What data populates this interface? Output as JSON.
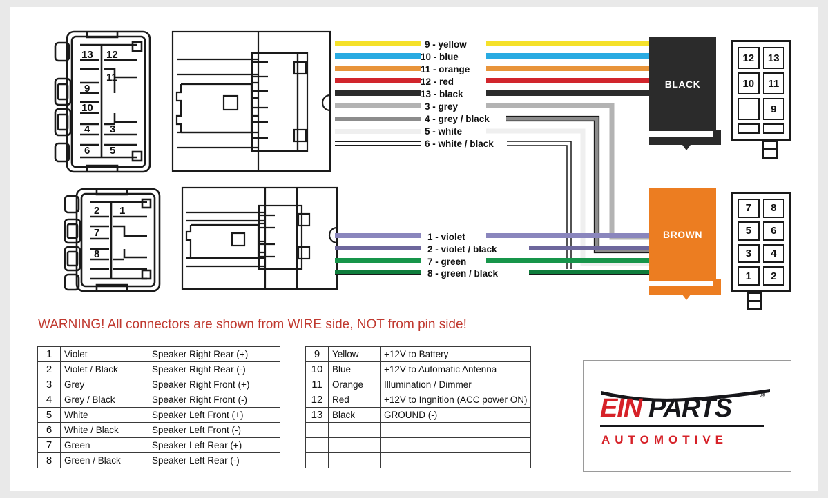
{
  "warning": {
    "text": "WARNING! All connectors are shown from WIRE side, NOT from pin side!",
    "color": "#c0392f"
  },
  "blocks": {
    "black": {
      "label": "BLACK",
      "color": "#2b2b2b",
      "text_color": "#ffffff"
    },
    "brown": {
      "label": "BROWN",
      "color": "#ec7d21",
      "text_color": "#ffffff"
    }
  },
  "wires_top": [
    {
      "pin": "9",
      "label": "9 - yellow",
      "color": "#f5e12a",
      "stripe": null
    },
    {
      "pin": "10",
      "label": "10 - blue",
      "color": "#29abe2",
      "stripe": null
    },
    {
      "pin": "11",
      "label": "11 - orange",
      "color": "#e8943a",
      "stripe": null
    },
    {
      "pin": "12",
      "label": "12 - red",
      "color": "#d1252c",
      "stripe": null
    },
    {
      "pin": "13",
      "label": "13 - black",
      "color": "#2b2b2b",
      "stripe": null
    },
    {
      "pin": "3",
      "label": "3 - grey",
      "color": "#b3b3b3",
      "stripe": null
    },
    {
      "pin": "4",
      "label": "4 - grey / black",
      "color": "#808080",
      "stripe": "#1a1a1a"
    },
    {
      "pin": "5",
      "label": "5 - white",
      "color": "#efefef",
      "stripe": null
    },
    {
      "pin": "6",
      "label": "6 - white / black",
      "color": "#ffffff",
      "stripe": "#1a1a1a"
    }
  ],
  "wires_bottom": [
    {
      "pin": "1",
      "label": "1 - violet",
      "color": "#8a86bd",
      "stripe": null
    },
    {
      "pin": "2",
      "label": "2 - violet / black",
      "color": "#6d679c",
      "stripe": "#1a1a1a"
    },
    {
      "pin": "7",
      "label": "7 - green",
      "color": "#17954a",
      "stripe": null
    },
    {
      "pin": "8",
      "label": "8 - green / black",
      "color": "#0f7d3c",
      "stripe": "#1a1a1a"
    }
  ],
  "connector_top_left": {
    "name": "13-pin connector",
    "pins": [
      "13",
      "12",
      "11",
      "9",
      "10",
      "4",
      "3",
      "6",
      "5"
    ]
  },
  "connector_bottom_left": {
    "name": "8-pin connector",
    "pins": [
      "2",
      "1",
      "7",
      "8"
    ]
  },
  "pingrid_black": {
    "rows": [
      [
        "12",
        "13"
      ],
      [
        "10",
        "11"
      ],
      [
        "",
        "9"
      ],
      [
        "",
        ""
      ]
    ]
  },
  "pingrid_brown": {
    "rows": [
      [
        "7",
        "8"
      ],
      [
        "5",
        "6"
      ],
      [
        "3",
        "4"
      ],
      [
        "1",
        "2"
      ]
    ]
  },
  "table_left": {
    "rows": [
      {
        "num": "1",
        "color": "Violet",
        "function": "Speaker Right Rear (+)"
      },
      {
        "num": "2",
        "color": "Violet / Black",
        "function": "Speaker Right Rear (-)"
      },
      {
        "num": "3",
        "color": "Grey",
        "function": "Speaker Right Front (+)"
      },
      {
        "num": "4",
        "color": "Grey / Black",
        "function": "Speaker Right Front (-)"
      },
      {
        "num": "5",
        "color": "White",
        "function": "Speaker Left Front (+)"
      },
      {
        "num": "6",
        "color": "White / Black",
        "function": "Speaker Left Front (-)"
      },
      {
        "num": "7",
        "color": "Green",
        "function": "Speaker Left Rear (+)"
      },
      {
        "num": "8",
        "color": "Green / Black",
        "function": "Speaker Left Rear (-)"
      }
    ]
  },
  "table_right": {
    "rows": [
      {
        "num": "9",
        "color": "Yellow",
        "function": "+12V to Battery"
      },
      {
        "num": "10",
        "color": "Blue",
        "function": "+12V to Automatic Antenna"
      },
      {
        "num": "11",
        "color": "Orange",
        "function": "Illumination / Dimmer"
      },
      {
        "num": "12",
        "color": "Red",
        "function": "+12V to Ingnition (ACC power ON)"
      },
      {
        "num": "13",
        "color": "Black",
        "function": "GROUND (-)"
      },
      {
        "num": "",
        "color": "",
        "function": ""
      },
      {
        "num": "",
        "color": "",
        "function": ""
      },
      {
        "num": "",
        "color": "",
        "function": ""
      }
    ]
  },
  "logo": {
    "part1": "EIN",
    "part2": "PARTS",
    "registered": "®",
    "tagline": "AUTOMOTIVE",
    "red": "#d62128",
    "black": "#16161a"
  }
}
